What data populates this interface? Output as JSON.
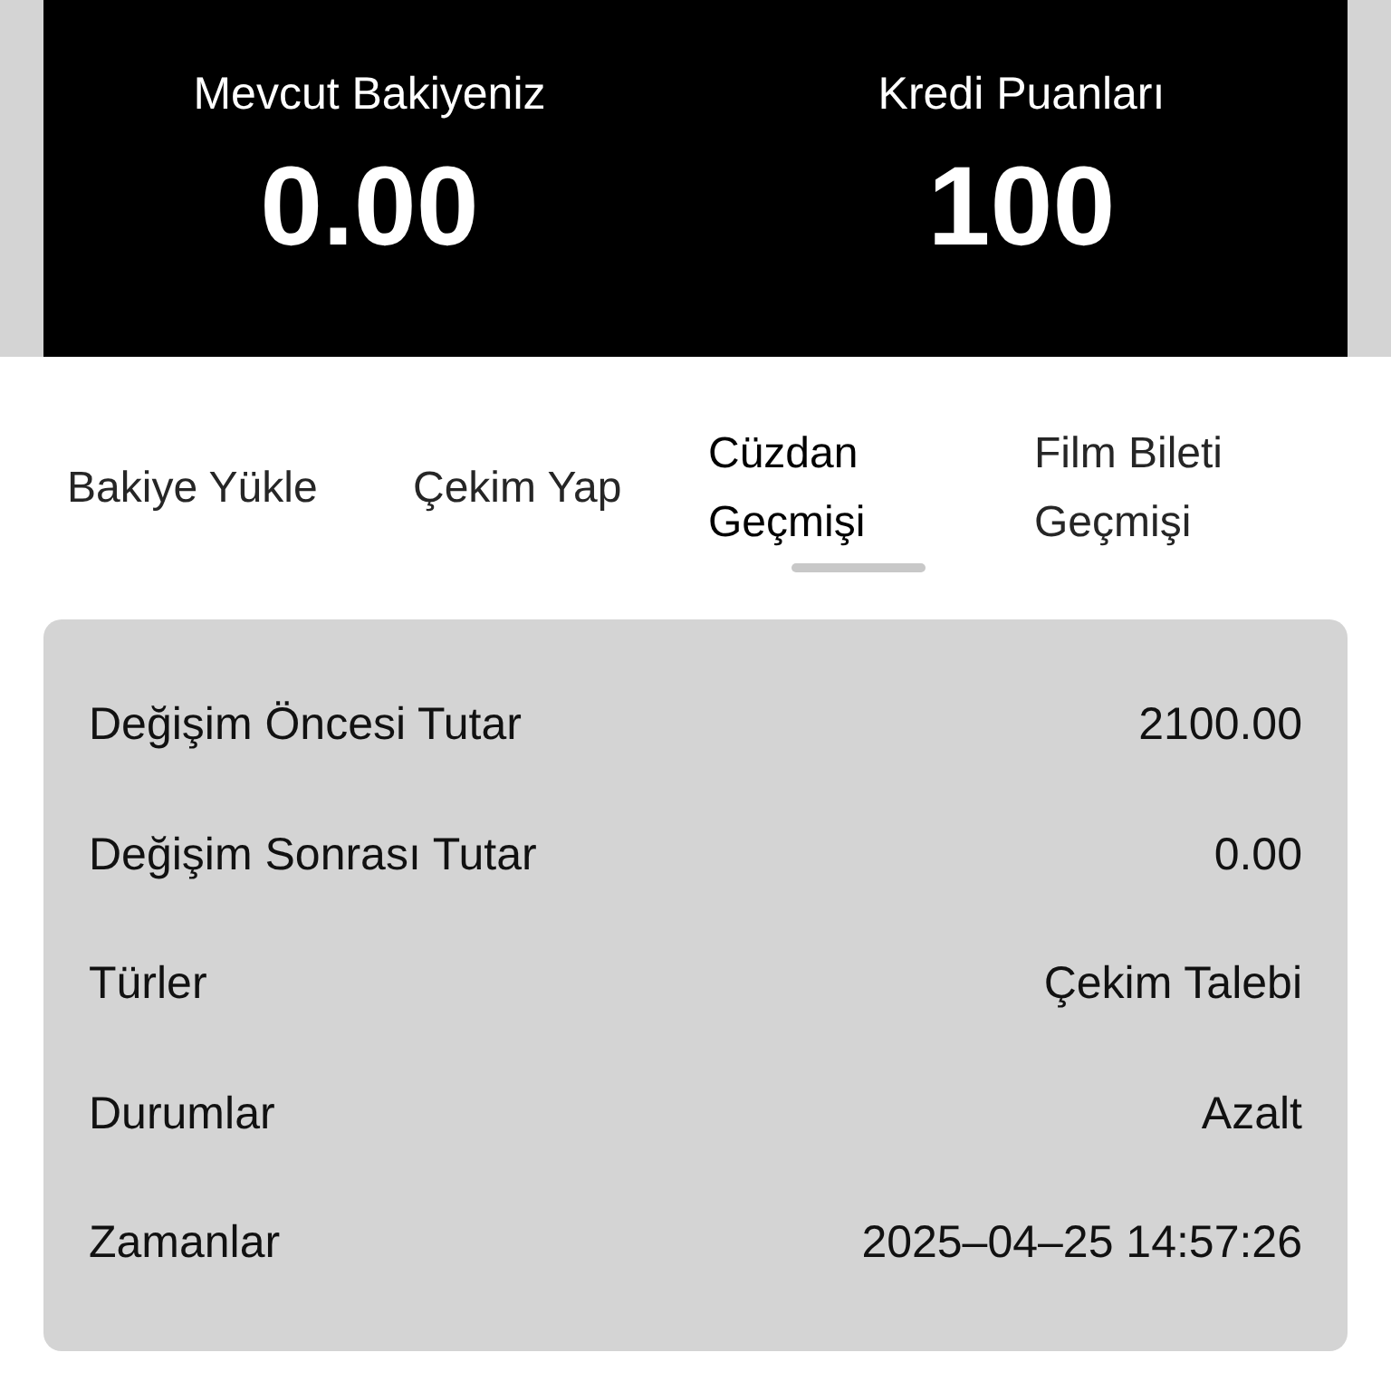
{
  "balance": {
    "label": "Mevcut Bakiyeniz",
    "value": "0.00"
  },
  "credit": {
    "label": "Kredi Puanları",
    "value": "100"
  },
  "tabs": [
    {
      "label": "Bakiye Yükle",
      "selected": false
    },
    {
      "label": "Çekim Yap",
      "selected": false
    },
    {
      "label": "Cüzdan Geçmişi",
      "selected": true
    },
    {
      "label": "Film Bileti Geçmişi",
      "selected": false
    }
  ],
  "details": [
    {
      "label": "Değişim Öncesi Tutar",
      "value": "2100.00"
    },
    {
      "label": "Değişim Sonrası Tutar",
      "value": "0.00"
    },
    {
      "label": "Türler",
      "value": "Çekim Talebi"
    },
    {
      "label": "Durumlar",
      "value": "Azalt"
    },
    {
      "label": "Zamanlar",
      "value": "2025–04–25 14:57:26"
    }
  ]
}
